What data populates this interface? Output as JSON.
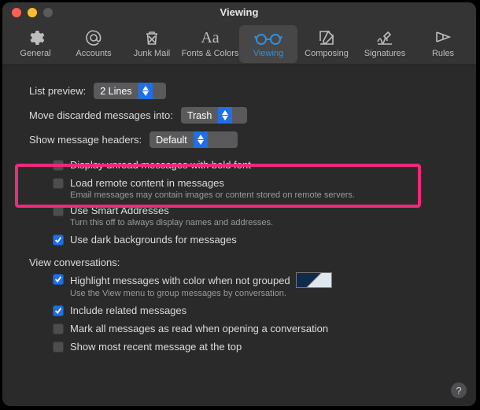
{
  "window": {
    "title": "Viewing"
  },
  "toolbar": {
    "items": [
      {
        "label": "General"
      },
      {
        "label": "Accounts"
      },
      {
        "label": "Junk Mail"
      },
      {
        "label": "Fonts & Colors"
      },
      {
        "label": "Viewing"
      },
      {
        "label": "Composing"
      },
      {
        "label": "Signatures"
      },
      {
        "label": "Rules"
      }
    ]
  },
  "prefs": {
    "list_preview_label": "List preview:",
    "list_preview_value": "2 Lines",
    "move_discarded_label": "Move discarded messages into:",
    "move_discarded_value": "Trash",
    "headers_label": "Show message headers:",
    "headers_value": "Default",
    "bold_unread": "Display unread messages with bold font",
    "remote_content": "Load remote content in messages",
    "remote_content_sub": "Email messages may contain images or content stored on remote servers.",
    "smart_addresses": "Use Smart Addresses",
    "smart_addresses_sub": "Turn this off to always display names and addresses.",
    "dark_bg": "Use dark backgrounds for messages",
    "view_conv_label": "View conversations:",
    "highlight": "Highlight messages with color when not grouped",
    "highlight_sub": "Use the View menu to group messages by conversation.",
    "include_related": "Include related messages",
    "mark_all_read": "Mark all messages as read when opening a conversation",
    "most_recent_top": "Show most recent message at the top"
  }
}
